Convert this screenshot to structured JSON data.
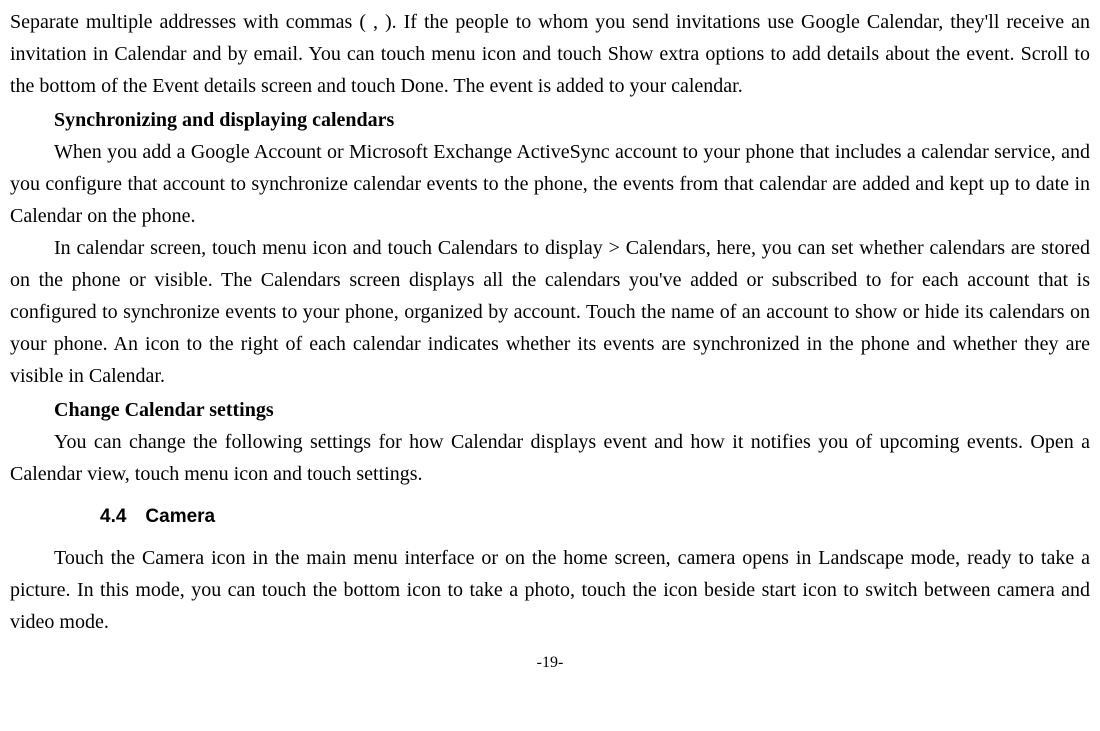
{
  "intro": "Separate multiple addresses with commas ( , ). If the people to whom you send invitations use Google Calendar, they'll receive an invitation in Calendar and by email. You can touch menu icon and touch Show extra options to add details about the event. Scroll to the bottom of the Event details screen and touch Done. The event is added to your calendar.",
  "sync_heading": "Synchronizing and displaying calendars",
  "sync_para1": "When you add a Google Account or Microsoft Exchange ActiveSync account to your phone that includes a calendar service, and you configure that account to synchronize calendar events to the phone, the events from that calendar are added and kept up to date in Calendar on the phone.",
  "sync_para2": "In calendar screen, touch menu icon and touch Calendars to display > Calendars, here, you can set whether calendars are stored on the phone or visible. The Calendars screen displays all the calendars you've added or subscribed to for each account that is configured to synchronize events to your phone, organized by account. Touch the name of an account to show or hide its calendars on your phone. An icon to the right of each calendar indicates whether its events are synchronized in the phone and whether they are visible in Calendar.",
  "change_heading": "Change Calendar settings",
  "change_para": "You can change the following settings for how Calendar displays event and how it notifies you of upcoming events. Open a Calendar view, touch menu icon and touch settings.",
  "section_heading": "4.4 Camera",
  "camera_para": "Touch the Camera icon in the main menu interface or on the home screen, camera opens in Landscape mode, ready to take a picture. In this mode, you can touch the bottom icon to take a photo, touch the icon beside start icon to switch between camera and video mode.",
  "page_number": "-19-"
}
